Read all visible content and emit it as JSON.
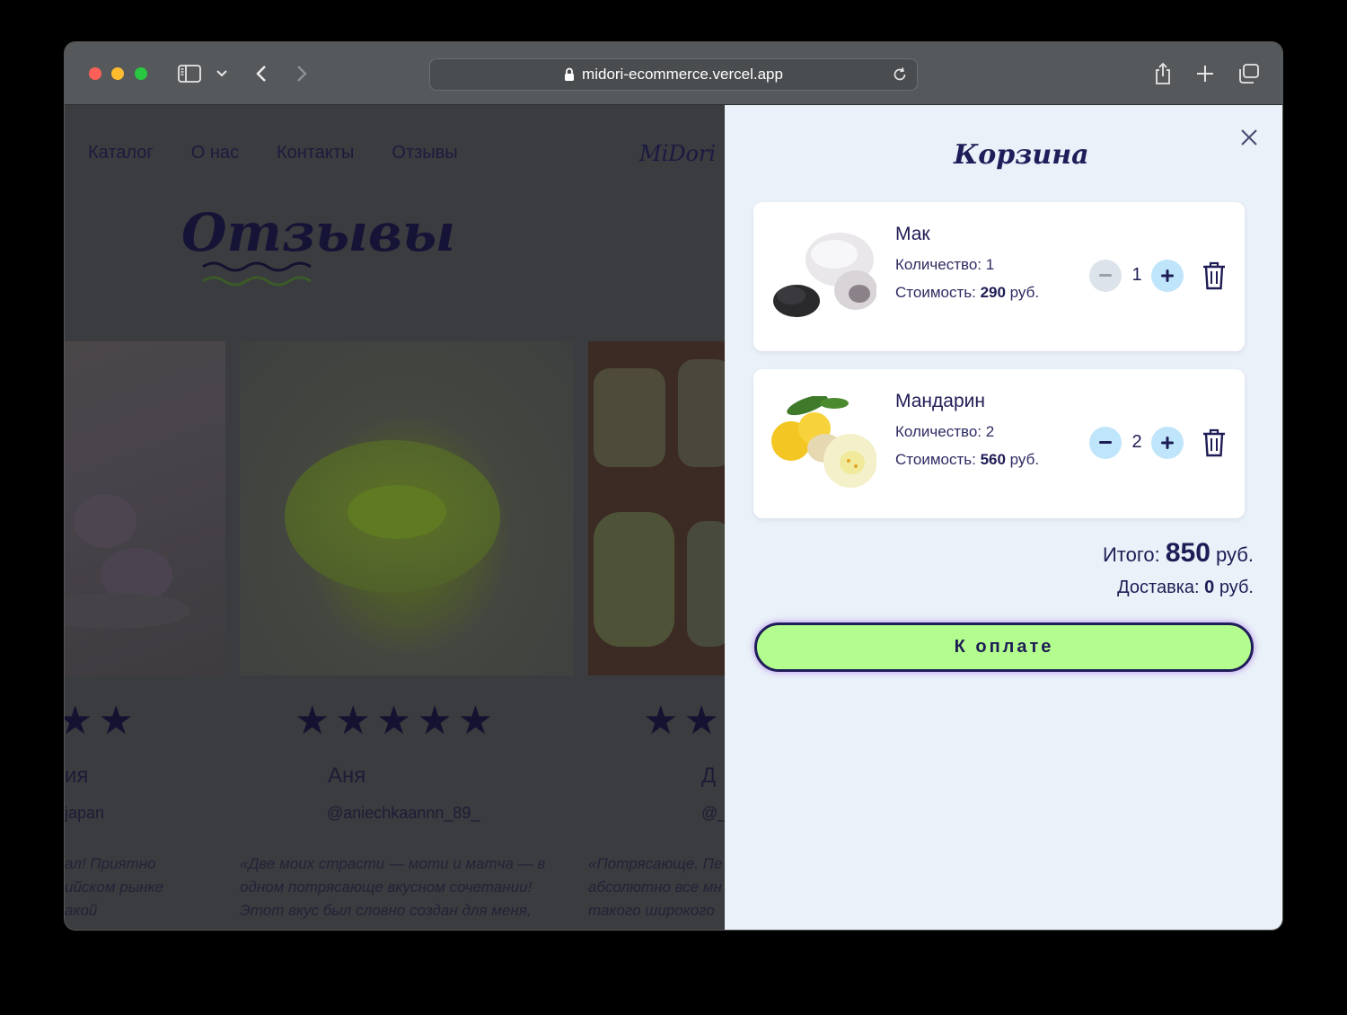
{
  "browser": {
    "url": "midori-ecommerce.vercel.app"
  },
  "site": {
    "nav": [
      "Каталог",
      "О нас",
      "Контакты",
      "Отзывы"
    ],
    "logo": "MiDori",
    "section_title": "Отзывы",
    "reviews": [
      {
        "stars": "★★",
        "name": "ия",
        "handle": "japan",
        "text": [
          "ал! Приятно",
          "ийском рынке",
          "акой"
        ]
      },
      {
        "stars": "★★★★★",
        "name": "Аня",
        "handle": "@aniechkaannn_89_",
        "text": [
          "«Две моих страсти — моти и матча — в",
          "одном потрясающе вкусном сочетании!",
          "Этот вкус был словно создан для меня,"
        ]
      },
      {
        "stars": "★★",
        "name": "Д",
        "handle": "@_",
        "text": [
          "«Потрясающе. Пе",
          "абсолютно все мн",
          "такого широкого"
        ]
      }
    ]
  },
  "cart": {
    "title": "Корзина",
    "items": [
      {
        "name": "Мак",
        "qty_label": "Количество: 1",
        "cost_label": "Стоимость: ",
        "cost_value": "290",
        "cost_unit": " руб.",
        "qty": "1"
      },
      {
        "name": "Мандарин",
        "qty_label": "Количество: 2",
        "cost_label": "Стоимость: ",
        "cost_value": "560",
        "cost_unit": " руб.",
        "qty": "2"
      }
    ],
    "total_label": "Итого: ",
    "total_value": "850",
    "total_unit": " руб.",
    "delivery_label": "Доставка: ",
    "delivery_value": "0",
    "delivery_unit": " руб.",
    "pay_button": "К оплате"
  },
  "colors": {
    "accent": "#1e1c55",
    "pay_button_bg": "#b3fd8e",
    "stepper_bg": "#bfe5fb",
    "panel_bg": "#eaf1f8"
  }
}
